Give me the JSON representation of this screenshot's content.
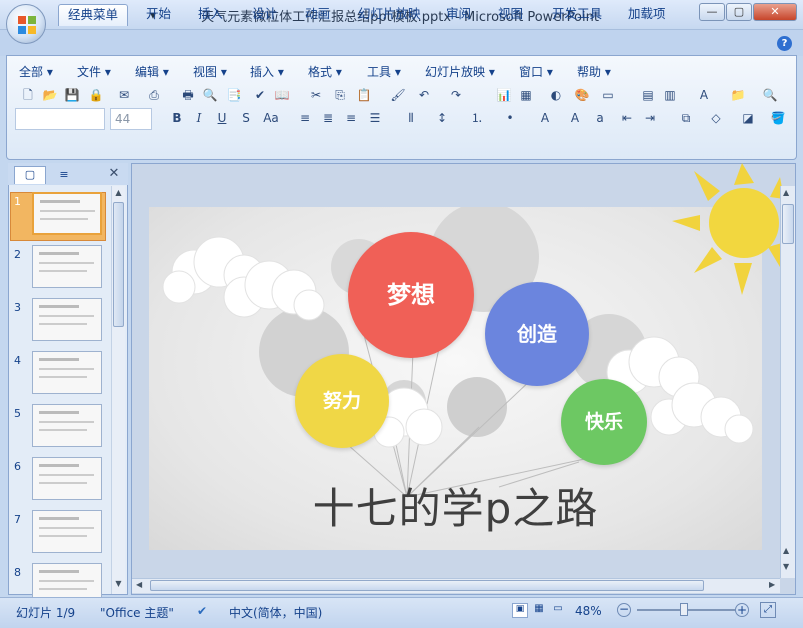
{
  "window": {
    "title": "天气元素微粒体工作汇报总结ppt模板.pptx - Microsoft PowerPoint",
    "minimize": "—",
    "maximize": "▢",
    "close": "✕"
  },
  "quick_access": {
    "save": "💾",
    "undo": "↶",
    "redo": "↻",
    "customize": "▾"
  },
  "ribbon_tabs": [
    "经典菜单",
    "开始",
    "插入",
    "设计",
    "动画",
    "幻灯片放映",
    "审阅",
    "视图",
    "开发工具",
    "加载项"
  ],
  "classic_menu": [
    "全部 ▾",
    "文件 ▾",
    "编辑 ▾",
    "视图 ▾",
    "插入 ▾",
    "格式 ▾",
    "工具 ▾",
    "幻灯片放映 ▾",
    "窗口 ▾",
    "帮助 ▾"
  ],
  "toolbar": {
    "font_name": "",
    "font_size": "44",
    "bold": "B",
    "italic": "I",
    "underline": "U",
    "shadow": "S",
    "strike": "Aa"
  },
  "slide_panel": {
    "tab_slides": "▢",
    "tab_outline": "≡",
    "close": "✕",
    "slides": [
      {
        "num": "1"
      },
      {
        "num": "2"
      },
      {
        "num": "3"
      },
      {
        "num": "4"
      },
      {
        "num": "5"
      },
      {
        "num": "6"
      },
      {
        "num": "7"
      },
      {
        "num": "8"
      }
    ]
  },
  "slide": {
    "balloons": [
      {
        "label": "梦想",
        "color": "#f06057"
      },
      {
        "label": "创造",
        "color": "#6b85de"
      },
      {
        "label": "努力",
        "color": "#f0d746"
      },
      {
        "label": "快乐",
        "color": "#6dc863"
      }
    ],
    "title": "十七的学p之路"
  },
  "status": {
    "slide_info": "幻灯片 1/9",
    "theme": "\"Office 主题\"",
    "language": "中文(简体，中国)",
    "zoom": "48%",
    "zoom_level": 0.48
  }
}
